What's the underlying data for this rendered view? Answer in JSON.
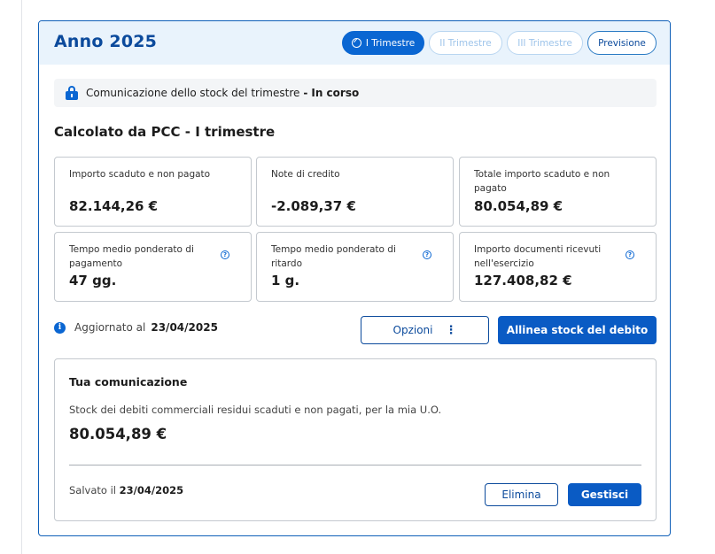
{
  "header": {
    "title": "Anno 2025",
    "tabs": [
      {
        "label": "I Trimestre",
        "state": "active"
      },
      {
        "label": "II Trimestre",
        "state": "disabled"
      },
      {
        "label": "III Trimestre",
        "state": "disabled"
      },
      {
        "label": "Previsione",
        "state": "enabled"
      }
    ]
  },
  "status": {
    "text": "Comunicazione dello stock del trimestre",
    "separator": "-",
    "value": "In corso",
    "icon": "lock-icon"
  },
  "section_title": "Calcolato da PCC - I trimestre",
  "metrics": [
    {
      "label": "Importo scaduto e non pagato",
      "value": "82.144,26 €",
      "help": false
    },
    {
      "label": "Note di credito",
      "value": "-2.089,37 €",
      "help": false
    },
    {
      "label": "Totale importo scaduto e non pagato",
      "value": "80.054,89 €",
      "help": false
    },
    {
      "label": "Tempo medio ponderato di pagamento",
      "value": "47 gg.",
      "help": true
    },
    {
      "label": "Tempo medio ponderato di ritardo",
      "value": "1 g.",
      "help": true
    },
    {
      "label": "Importo documenti ricevuti nell'esercizio",
      "value": "127.408,82 €",
      "help": true
    }
  ],
  "update": {
    "label": "Aggiornato al",
    "date": "23/04/2025"
  },
  "actions": {
    "options_label": "Opzioni",
    "align_label": "Allinea stock del debito"
  },
  "communication": {
    "title": "Tua comunicazione",
    "description": "Stock dei debiti commerciali residui scaduti e non pagati, per la mia U.O.",
    "value": "80.054,89 €",
    "saved_label": "Salvato il",
    "saved_date": "23/04/2025",
    "delete_label": "Elimina",
    "manage_label": "Gestisci"
  },
  "colors": {
    "primary": "#0a66d2",
    "header_bg": "#e9f3fc",
    "card_border": "#0f5fb8"
  }
}
